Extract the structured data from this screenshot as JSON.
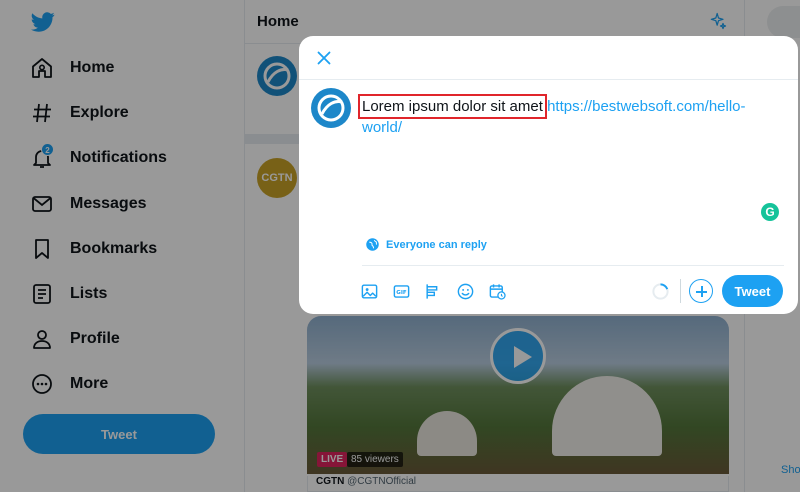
{
  "colors": {
    "accent": "#1da1f2",
    "highlight_box": "#e0252b",
    "live": "#e0245e",
    "grammarly": "#15c39a"
  },
  "sidebar": {
    "logo_icon": "twitter-bird-icon",
    "items": [
      {
        "label": "Home",
        "icon": "home-icon"
      },
      {
        "label": "Explore",
        "icon": "hashtag-icon"
      },
      {
        "label": "Notifications",
        "icon": "bell-icon",
        "badge": "2"
      },
      {
        "label": "Messages",
        "icon": "envelope-icon"
      },
      {
        "label": "Bookmarks",
        "icon": "bookmark-icon"
      },
      {
        "label": "Lists",
        "icon": "list-icon"
      },
      {
        "label": "Profile",
        "icon": "person-icon"
      },
      {
        "label": "More",
        "icon": "more-icon"
      }
    ],
    "tweet_button": "Tweet"
  },
  "main": {
    "title": "Home",
    "feed": {
      "author_avatar_text": "CGTN",
      "live_label": "LIVE",
      "viewers": "85 viewers",
      "author_name": "CGTN",
      "author_handle": "@CGTNOfficial"
    }
  },
  "right": {
    "show_more": "Show"
  },
  "modal": {
    "text_highlighted": "Lorem ipsum dolor sit amet",
    "text_url": "https://bestwebsoft.com/hello-world/",
    "grammarly_letter": "G",
    "reply_setting": "Everyone can reply",
    "toolbar": [
      "image-icon",
      "gif-icon",
      "poll-icon",
      "emoji-icon",
      "schedule-icon"
    ],
    "tweet_button": "Tweet"
  }
}
